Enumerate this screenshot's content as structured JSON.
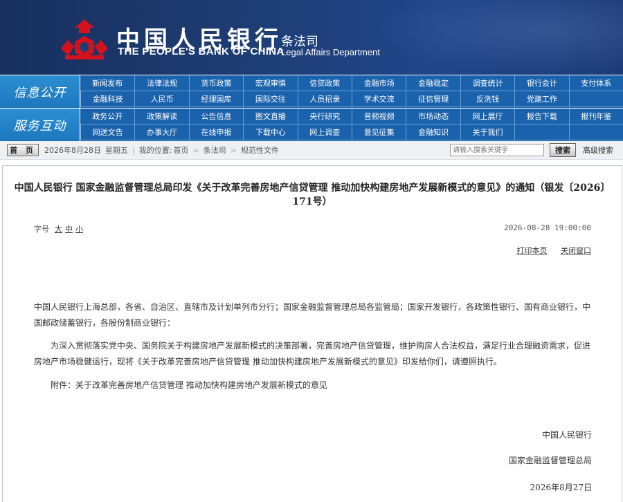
{
  "header": {
    "bank_cn": "中国人民银行",
    "bank_en": "THE PEOPLE'S BANK OF CHINA",
    "dept_cn": "条法司",
    "dept_en": "Legal Affairs Department",
    "logo_icon": "pboc-emblem-icon",
    "logo_color": "#d4121b"
  },
  "nav": {
    "sections": [
      {
        "label": "信息公开",
        "items": [
          "新闻发布",
          "法律法规",
          "货币政策",
          "宏观审慎",
          "信贷政策",
          "金融市场",
          "金融稳定",
          "调查统计",
          "银行会计",
          "支付体系",
          "金融科技",
          "人民币",
          "经理国库",
          "国际交往",
          "人员招录",
          "学术交流",
          "征信管理",
          "反洗钱",
          "党建工作",
          ""
        ]
      },
      {
        "label": "服务互动",
        "items": [
          "政务公开",
          "政策解读",
          "公告信息",
          "图文直播",
          "央行研究",
          "音频视频",
          "市场动态",
          "网上展厅",
          "报告下载",
          "报刊年鉴",
          "网送文告",
          "办事大厅",
          "在线申报",
          "下载中心",
          "网上调查",
          "意见征集",
          "金融知识",
          "关于我们",
          "",
          ""
        ]
      }
    ]
  },
  "toolbar": {
    "home_label": "首 页",
    "date": "2026年8月28日",
    "weekday": "星期五",
    "location_label": "我的位置:",
    "crumbs": [
      "首页",
      "条法司",
      "规范性文件"
    ],
    "search_placeholder": "请输入搜索关键字",
    "search_label": "搜索",
    "advanced_label": "高级搜索"
  },
  "article": {
    "title": "中国人民银行 国家金融监督管理总局印发《关于改革完善房地产信贷管理 推动加快构建房地产发展新模式的意见》的通知（银发〔2026〕171号）",
    "font_label": "字号",
    "font_large": "大",
    "font_medium": "中",
    "font_small": "小",
    "datetime": "2026-08-28 19:00:00",
    "print_label": "打印本页",
    "close_label": "关闭窗口",
    "recipients": "中国人民银行上海总部，各省、自治区、直辖市及计划单列市分行；国家金融监督管理总局各监管局；国家开发银行，各政策性银行、国有商业银行，中国邮政储蓄银行，各股份制商业银行：",
    "paragraph": "为深入贯彻落实党中央、国务院关于构建房地产发展新模式的决策部署，完善房地产信贷管理，维护购房人合法权益，满足行业合理融资需求，促进房地产市场稳健运行，现将《关于改革完善房地产信贷管理 推动加快构建房地产发展新模式的意见》印发给你们，请遵照执行。",
    "attachment": "附件：关于改革完善房地产信贷管理 推动加快构建房地产发展新模式的意见",
    "signer1": "中国人民银行",
    "signer2": "国家金融监督管理总局",
    "sign_date": "2026年8月27日"
  }
}
